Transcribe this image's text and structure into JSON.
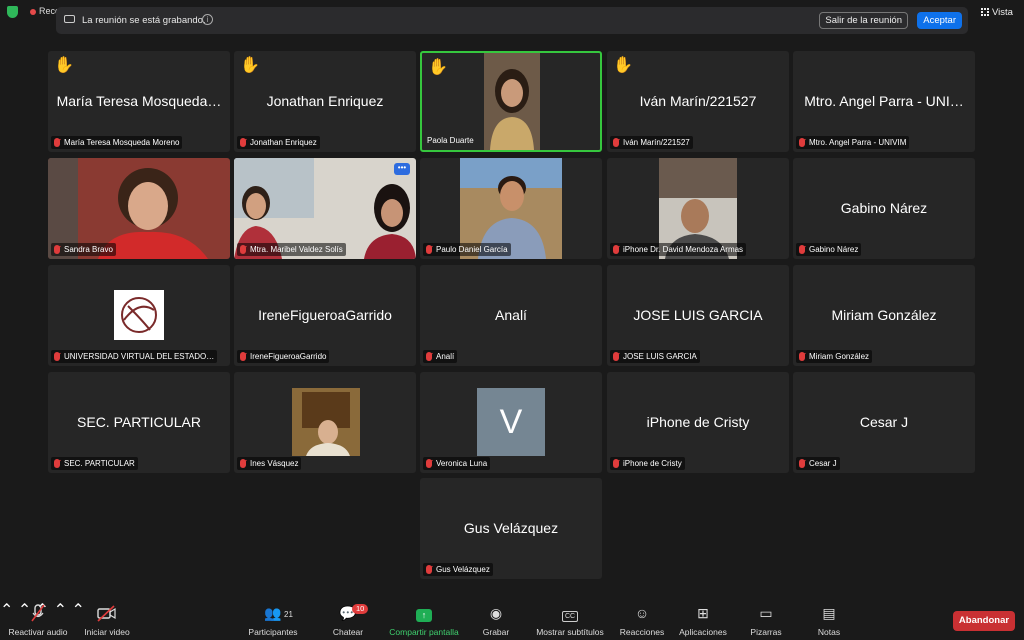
{
  "recording_indicator": "Recc",
  "banner": {
    "message": "La reunión se está grabando.",
    "leave_button": "Salir de la reunión",
    "accept_button": "Aceptar"
  },
  "view_button": "Vista",
  "tiles": [
    {
      "big": "María Teresa Mosqueda…",
      "label": "María Teresa Mosqueda Moreno",
      "hand": true
    },
    {
      "big": "Jonathan Enriquez",
      "label": "Jonathan Enriquez",
      "hand": true
    },
    {
      "big": "",
      "label": "Paola Duarte",
      "hand": true,
      "video": true,
      "active": true
    },
    {
      "big": "Iván Marín/221527",
      "label": "Iván Marín/221527",
      "hand": true
    },
    {
      "big": "Mtro. Angel Parra - UNI…",
      "label": "Mtro. Angel Parra - UNIVIM"
    },
    {
      "big": "",
      "label": "Sandra Bravo",
      "video": true
    },
    {
      "big": "",
      "label": "Mtra. Maribel Valdez Solís",
      "video": true
    },
    {
      "big": "",
      "label": "Paulo Daniel García",
      "video": true
    },
    {
      "big": "",
      "label": "iPhone Dr. David Mendoza Armas",
      "video": true
    },
    {
      "big": "Gabino Nárez",
      "label": "Gabino Nárez"
    },
    {
      "big": "",
      "label": "UNIVERSIDAD VIRTUAL DEL ESTADO…",
      "logo": true
    },
    {
      "big": "IreneFigueroaGarrido",
      "label": "IreneFigueroaGarrido"
    },
    {
      "big": "Analí",
      "label": "Analí"
    },
    {
      "big": "JOSE LUIS GARCIA",
      "label": "JOSE LUIS GARCIA"
    },
    {
      "big": "Miriam González",
      "label": "Miriam González"
    },
    {
      "big": "SEC. PARTICULAR",
      "label": "SEC. PARTICULAR"
    },
    {
      "big": "",
      "label": "Ines Vásquez",
      "video": true
    },
    {
      "big": "",
      "label": "Veronica Luna",
      "avatar": "V"
    },
    {
      "big": "iPhone de Cristy",
      "label": "iPhone de Cristy"
    },
    {
      "big": "Cesar J",
      "label": "Cesar J"
    },
    {
      "big": "Gus Velázquez",
      "label": "Gus Velázquez"
    }
  ],
  "toolbar": {
    "unmute": "Reactivar audio",
    "start_video": "Iniciar video",
    "participants": "Participantes",
    "participants_count": "21",
    "chat": "Chatear",
    "chat_badge": "10",
    "share": "Compartir pantalla",
    "record": "Grabar",
    "captions": "Mostrar subtítulos",
    "reactions": "Reacciones",
    "apps": "Aplicaciones",
    "whiteboards": "Pizarras",
    "notes": "Notas",
    "leave": "Abandonar"
  },
  "colors": {
    "accent": "#0e71eb",
    "active_speaker": "#36c73e",
    "leave": "#c93033",
    "share": "#1fae55"
  }
}
